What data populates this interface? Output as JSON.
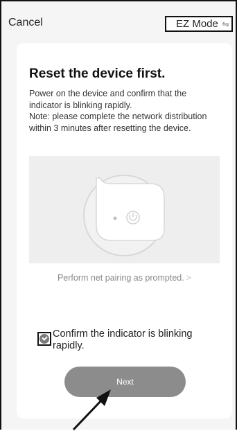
{
  "header": {
    "cancel_label": "Cancel",
    "mode_label": "EZ Mode",
    "mode_icon": "⇋"
  },
  "card": {
    "title": "Reset the device first.",
    "description_lines": [
      "Power on the device and confirm that the indicator is blinking rapidly.",
      "Note: please complete the network distribution within 3 minutes after resetting the device."
    ],
    "pairing_link": "Perform net pairing as prompted.",
    "pairing_chevron": ">",
    "confirm_label": "Confirm the indicator is blinking rapidly.",
    "confirm_checked": true,
    "next_label": "Next"
  },
  "colors": {
    "background": "#f5f5f5",
    "card": "#ffffff",
    "button": "#8c8c8c",
    "muted_text": "#888888"
  }
}
